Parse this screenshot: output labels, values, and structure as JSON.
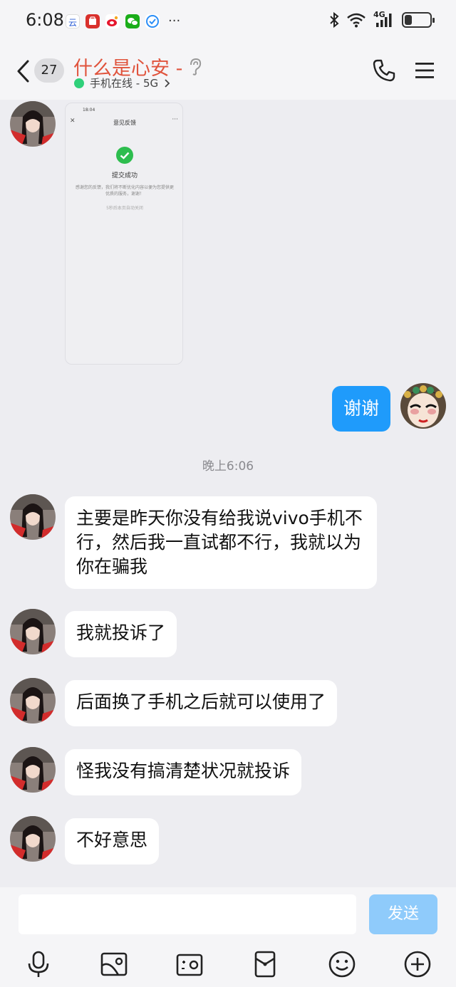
{
  "status_bar": {
    "time": "6:08",
    "network": "4G",
    "battery_level": 0.3,
    "more": "···"
  },
  "header": {
    "unread_count": "27",
    "contact_name": "什么是心安 -",
    "status": "手机在线 - 5G",
    "status_color": "#2fd07a",
    "title_color": "#e0533c"
  },
  "screenshot_thumb": {
    "status_time": "18:04",
    "page_title": "意见反馈",
    "success_text": "提交成功",
    "description": "感谢您的反馈，我们将不断优化内容以便为您提供更优质的服务，谢谢！",
    "auto_close": "5秒后本页自动关闭"
  },
  "messages": {
    "outgoing_1": "谢谢",
    "timestamp": "晚上6:06",
    "incoming_1": "主要是昨天你没有给我说vivo手机不行，然后我一直试都不行，我就以为你在骗我",
    "incoming_2": "我就投诉了",
    "incoming_3": "后面换了手机之后就可以使用了",
    "incoming_4": "怪我没有搞清楚状况就投诉",
    "incoming_5": "不好意思"
  },
  "composer": {
    "input_value": "",
    "send_label": "发送",
    "accent": "#1f9bfb"
  },
  "toolbar_icons": [
    "microphone-icon",
    "image-icon",
    "camera-icon",
    "red-packet-icon",
    "emoji-icon",
    "plus-icon"
  ]
}
